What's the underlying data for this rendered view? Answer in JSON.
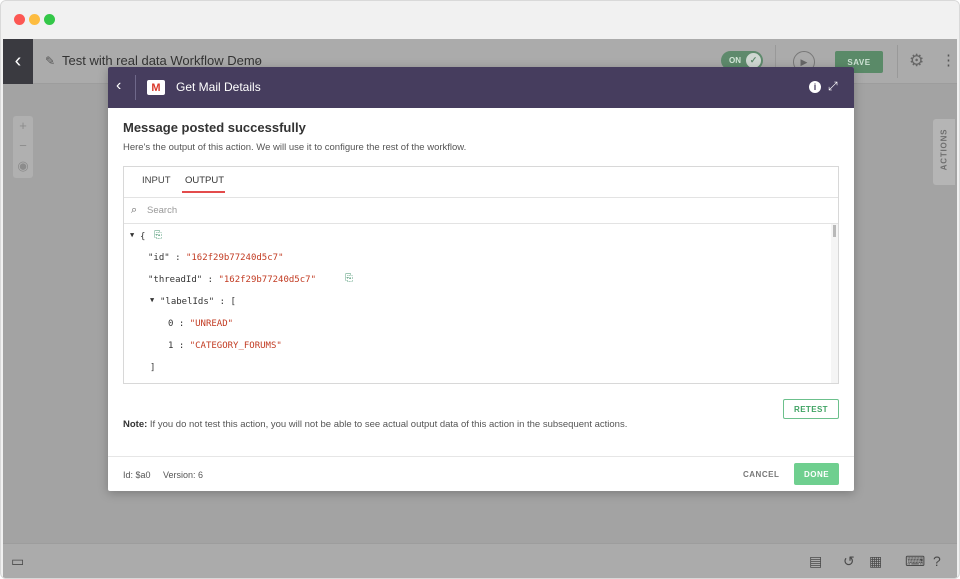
{
  "app": {
    "back_icon": "chevron-left-icon",
    "workflow_title": "Test with real data Workflow Demo",
    "toggle_label": "ON",
    "save_label": "SAVE",
    "actions_tab": "ACTIONS",
    "zoom": {
      "in": "+",
      "out": "−",
      "center": "◉"
    }
  },
  "modal": {
    "title": "Get Mail Details",
    "app_icon": "gmail-icon",
    "header_color": "#463d5e",
    "heading": "Message posted successfully",
    "subheading": "Here's the output of this action. We will use it to configure the rest of the workflow.",
    "tabs": [
      {
        "label": "INPUT",
        "active": false
      },
      {
        "label": "OUTPUT",
        "active": true
      }
    ],
    "search_placeholder": "Search",
    "output": {
      "open_brace": "{",
      "fields": [
        {
          "key": "\"id\"",
          "sep": " : ",
          "value": "\"162f29b77240d5c7\""
        },
        {
          "key": "\"threadId\"",
          "sep": " : ",
          "value": "\"162f29b77240d5c7\""
        }
      ],
      "labelIds": {
        "key": "\"labelIds\"",
        "sep": " : ",
        "open": "[",
        "items": [
          {
            "index": "0",
            "sep": " : ",
            "value": "\"UNREAD\""
          },
          {
            "index": "1",
            "sep": " : ",
            "value": "\"CATEGORY_FORUMS\""
          }
        ],
        "close": "]"
      }
    },
    "retest_label": "RETEST",
    "note_label": "Note:",
    "note_text": " If you do not test this action, you will not be able to see actual output data of this action in the subsequent actions.",
    "footer": {
      "id_text": "Id: $a0",
      "version_text": "Version: 6",
      "cancel_label": "CANCEL",
      "done_label": "DONE"
    },
    "accent_green": "#6fcf8f",
    "accent_red": "#e34b4b"
  }
}
